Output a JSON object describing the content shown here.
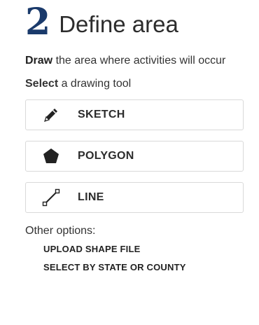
{
  "step": {
    "number": "2",
    "title": "Define area"
  },
  "instruction": {
    "bold": "Draw",
    "rest": " the area where activities will occur"
  },
  "select": {
    "bold": "Select",
    "rest": " a drawing tool"
  },
  "tools": [
    {
      "label": "SKETCH",
      "icon": "pencil-icon"
    },
    {
      "label": "POLYGON",
      "icon": "pentagon-icon"
    },
    {
      "label": "LINE",
      "icon": "line-icon"
    }
  ],
  "other_options": {
    "label": "Other options:",
    "links": [
      "UPLOAD SHAPE FILE",
      "SELECT BY STATE OR COUNTY"
    ]
  },
  "colors": {
    "step_number": "#1a3a6b",
    "text": "#333333",
    "border": "#d9d9d9"
  }
}
